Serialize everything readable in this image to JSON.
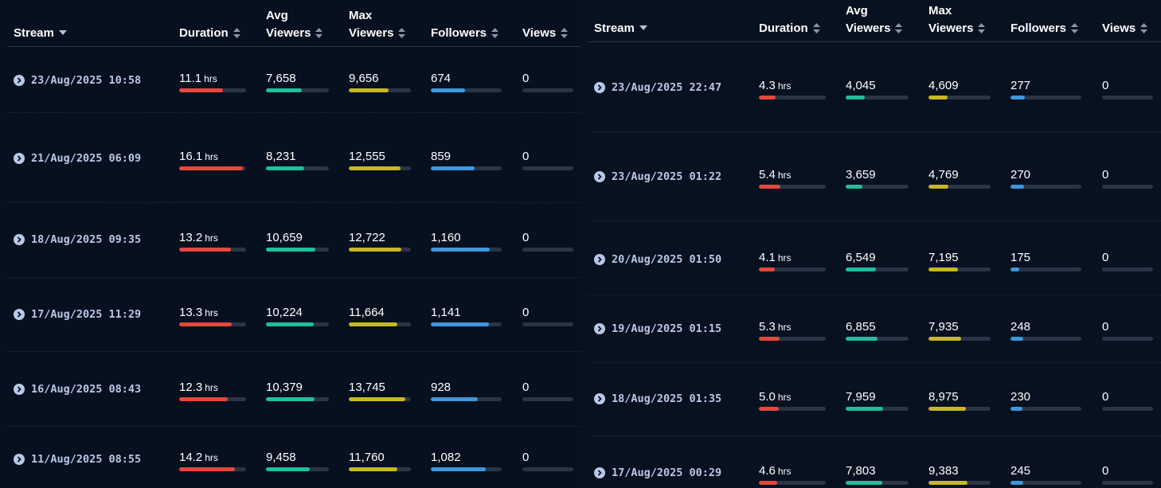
{
  "headers": {
    "stream": "Stream",
    "duration": "Duration",
    "avg_line1": "Avg",
    "avg_line2": "Viewers",
    "max_line1": "Max",
    "max_line2": "Viewers",
    "followers": "Followers",
    "views": "Views"
  },
  "units": {
    "hours": "hrs"
  },
  "colors": {
    "duration": "#e6483b",
    "avg": "#1fbf9d",
    "max": "#c6b824",
    "followers": "#3c97dd",
    "track": "#2a3444",
    "stream_text": "#b7c9e6"
  },
  "scales": {
    "duration_max_hrs": 17,
    "avg_max": 13500,
    "max_max": 15000,
    "followers_max": 1400
  },
  "left": {
    "rows": [
      {
        "stream": "23/Aug/2025 10:58",
        "duration": "11.1",
        "avg": "7,658",
        "max": "9,656",
        "followers": "674",
        "views": "0"
      },
      {
        "stream": "21/Aug/2025 06:09",
        "duration": "16.1",
        "avg": "8,231",
        "max": "12,555",
        "followers": "859",
        "views": "0"
      },
      {
        "stream": "18/Aug/2025 09:35",
        "duration": "13.2",
        "avg": "10,659",
        "max": "12,722",
        "followers": "1,160",
        "views": "0"
      },
      {
        "stream": "17/Aug/2025 11:29",
        "duration": "13.3",
        "avg": "10,224",
        "max": "11,664",
        "followers": "1,141",
        "views": "0"
      },
      {
        "stream": "16/Aug/2025 08:43",
        "duration": "12.3",
        "avg": "10,379",
        "max": "13,745",
        "followers": "928",
        "views": "0"
      },
      {
        "stream": "11/Aug/2025 08:55",
        "duration": "14.2",
        "avg": "9,458",
        "max": "11,760",
        "followers": "1,082",
        "views": "0"
      }
    ]
  },
  "right": {
    "rows": [
      {
        "stream": "23/Aug/2025 22:47",
        "duration": "4.3",
        "avg": "4,045",
        "max": "4,609",
        "followers": "277",
        "views": "0"
      },
      {
        "stream": "23/Aug/2025 01:22",
        "duration": "5.4",
        "avg": "3,659",
        "max": "4,769",
        "followers": "270",
        "views": "0"
      },
      {
        "stream": "20/Aug/2025 01:50",
        "duration": "4.1",
        "avg": "6,549",
        "max": "7,195",
        "followers": "175",
        "views": "0"
      },
      {
        "stream": "19/Aug/2025 01:15",
        "duration": "5.3",
        "avg": "6,855",
        "max": "7,935",
        "followers": "248",
        "views": "0"
      },
      {
        "stream": "18/Aug/2025 01:35",
        "duration": "5.0",
        "avg": "7,959",
        "max": "8,975",
        "followers": "230",
        "views": "0"
      },
      {
        "stream": "17/Aug/2025 00:29",
        "duration": "4.6",
        "avg": "7,803",
        "max": "9,383",
        "followers": "245",
        "views": "0"
      }
    ]
  }
}
